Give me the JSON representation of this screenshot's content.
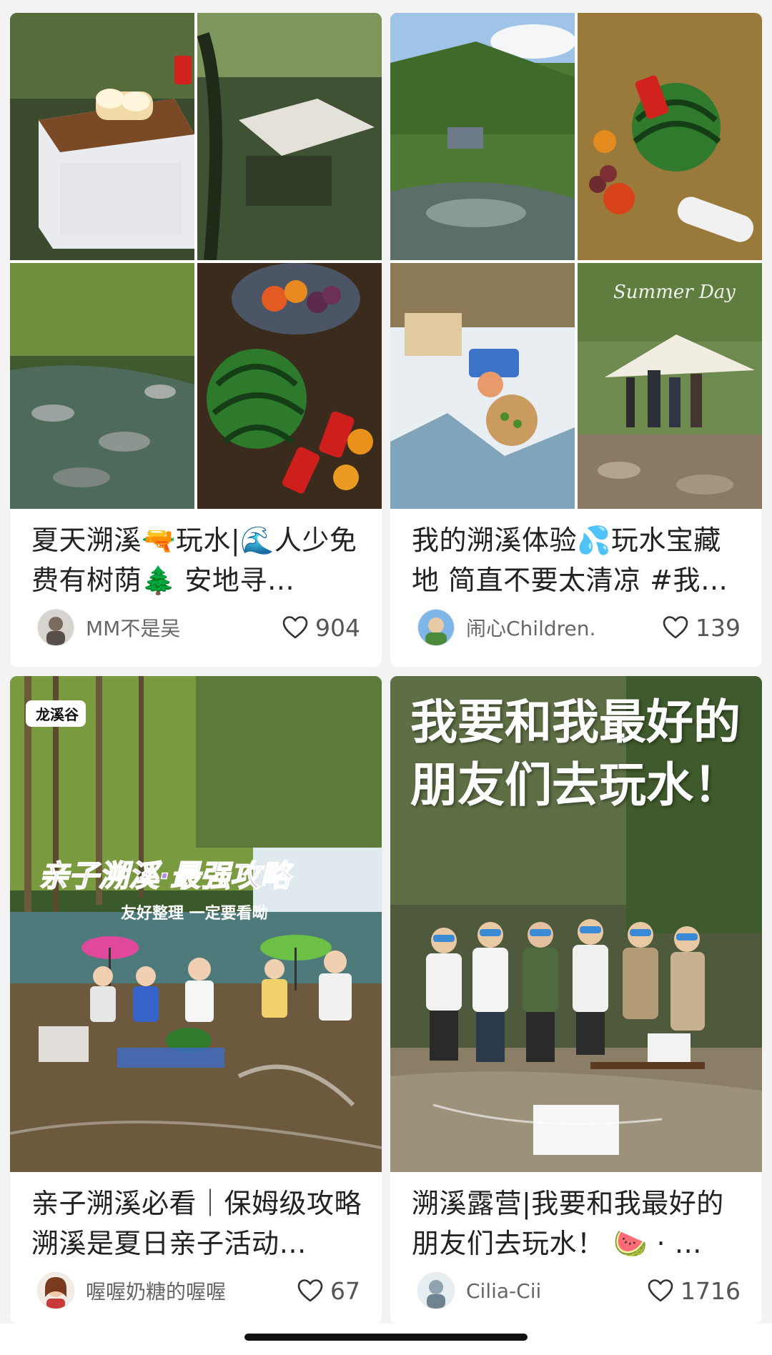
{
  "feed": {
    "cards": [
      {
        "title": "夏天溯溪🔫玩水|🌊人少免费有树荫🌲 安地寻…",
        "author": "MM不是吴",
        "likes": "904",
        "cover_overlay": "",
        "avatar_icon": "avatar-photo-icon"
      },
      {
        "title": "我的溯溪体验💦玩水宝藏地 简直不要太清凉 #我…",
        "author": "闹心Children.",
        "likes": "139",
        "cover_overlay": "Summer Day",
        "avatar_icon": "avatar-photo-icon"
      },
      {
        "title": "亲子溯溪必看｜保姆级攻略 溯溪是夏日亲子活动…",
        "author": "喔喔奶糖的喔喔",
        "likes": "67",
        "cover_badge": "龙溪谷",
        "cover_headline": "亲子溯溪·最强攻略",
        "cover_subline": "友好整理 一定要看呦",
        "avatar_icon": "avatar-photo-icon"
      },
      {
        "title": "溯溪露营|我要和我最好的朋友们去玩水！ 🍉 · …",
        "author": "Cilia-Cii",
        "likes": "1716",
        "cover_headline": "我要和我最好的朋友们去玩水！",
        "avatar_icon": "avatar-photo-icon"
      }
    ]
  },
  "colors": {
    "background": "#f3f3f3",
    "card": "#ffffff",
    "title_text": "#222222",
    "meta_text": "#666666",
    "heading_purple": "#b98be8"
  },
  "icons": {
    "like": "heart-outline-icon",
    "home_indicator": "home-indicator-bar"
  }
}
